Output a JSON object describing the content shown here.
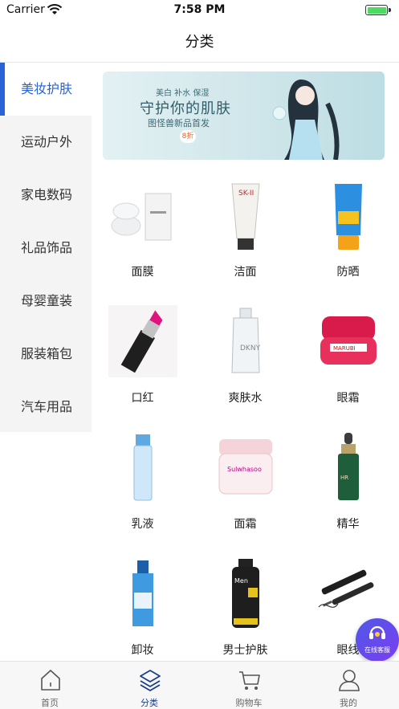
{
  "status_bar": {
    "carrier": "Carrier",
    "time": "7:58 PM",
    "battery_color": "#4cd964"
  },
  "nav": {
    "title": "分类"
  },
  "sidebar": {
    "active_color": "#2a63d8",
    "items": [
      {
        "label": "美妆护肤",
        "active": true
      },
      {
        "label": "运动户外",
        "active": false
      },
      {
        "label": "家电数码",
        "active": false
      },
      {
        "label": "礼品饰品",
        "active": false
      },
      {
        "label": "母婴童装",
        "active": false
      },
      {
        "label": "服装箱包",
        "active": false
      },
      {
        "label": "汽车用品",
        "active": false
      }
    ]
  },
  "banner": {
    "line1": "美白 补水 保湿",
    "line2": "守护你的肌肤",
    "line3": "图怪兽新品首发",
    "badge": "8折"
  },
  "products": [
    {
      "label": "面膜",
      "icon": "mask-compact"
    },
    {
      "label": "洁面",
      "icon": "cleanser-tube"
    },
    {
      "label": "防晒",
      "icon": "sunscreen-bottle"
    },
    {
      "label": "口红",
      "icon": "lipstick"
    },
    {
      "label": "爽肤水",
      "icon": "toner-bottle"
    },
    {
      "label": "眼霜",
      "icon": "eye-cream-jar"
    },
    {
      "label": "乳液",
      "icon": "lotion-bottle"
    },
    {
      "label": "面霜",
      "icon": "face-cream-jar"
    },
    {
      "label": "精华",
      "icon": "serum-dropper"
    },
    {
      "label": "卸妆",
      "icon": "makeup-remover"
    },
    {
      "label": "男士护肤",
      "icon": "mens-bottle"
    },
    {
      "label": "眼线",
      "icon": "eyeliner"
    }
  ],
  "service": {
    "label": "在线客服"
  },
  "tabs": [
    {
      "label": "首页",
      "icon": "home-icon",
      "active": false
    },
    {
      "label": "分类",
      "icon": "layers-icon",
      "active": true
    },
    {
      "label": "购物车",
      "icon": "cart-icon",
      "active": false
    },
    {
      "label": "我的",
      "icon": "user-icon",
      "active": false
    }
  ]
}
